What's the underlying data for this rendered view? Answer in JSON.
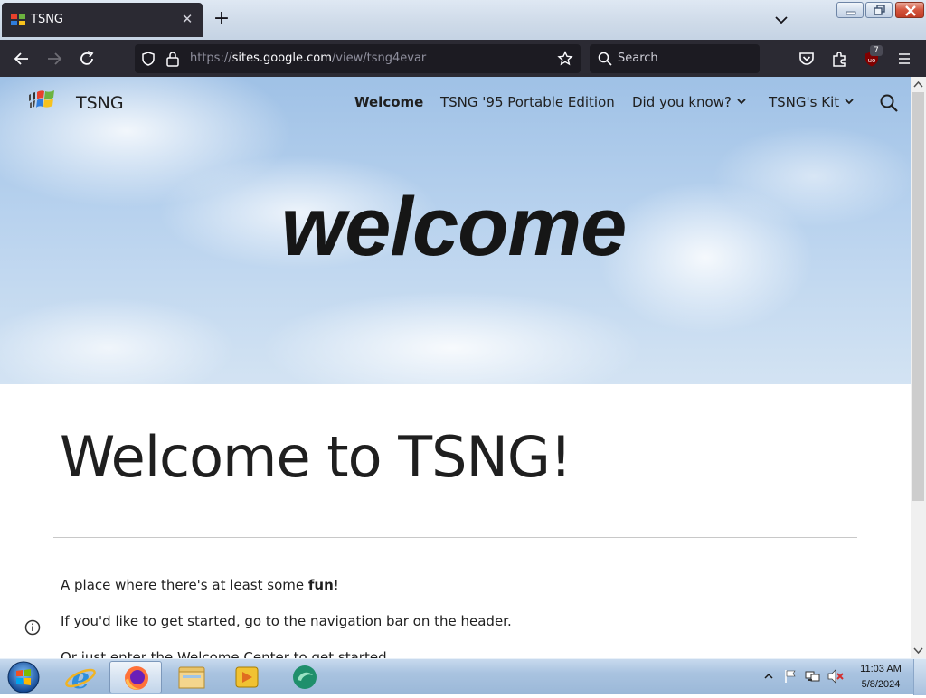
{
  "browser": {
    "tab": {
      "title": "TSNG"
    },
    "url": {
      "prefix": "https://",
      "host": "sites.google.com",
      "path": "/view/tsng4evar"
    },
    "search_placeholder": "Search",
    "extension_badge": "7"
  },
  "site": {
    "name": "TSNG",
    "nav": [
      {
        "label": "Welcome",
        "active": true
      },
      {
        "label": "TSNG '95 Portable Edition",
        "active": false
      },
      {
        "label": "Did you know?",
        "has_dropdown": true
      },
      {
        "label": "TSNG's Kit",
        "has_dropdown": true
      }
    ],
    "hero_title": "welcome",
    "heading": "Welcome to TSNG!",
    "paragraphs": {
      "p1_before": "A place where there's at least some ",
      "p1_bold": "fun",
      "p1_after": "!",
      "p2": "If you'd like to get started, go to the navigation bar on the header.",
      "p3": "Or just enter the Welcome Center to get started."
    }
  },
  "taskbar": {
    "apps": [
      "internet-explorer",
      "firefox",
      "file-explorer",
      "media-player",
      "app-icon"
    ],
    "clock_time": "11:03 AM",
    "clock_date": "5/8/2024"
  },
  "colors": {
    "browser_chrome": "#2b2a33",
    "url_field": "#1c1b22",
    "sky_top": "#9fc1e6",
    "text": "#1f1f1f"
  }
}
